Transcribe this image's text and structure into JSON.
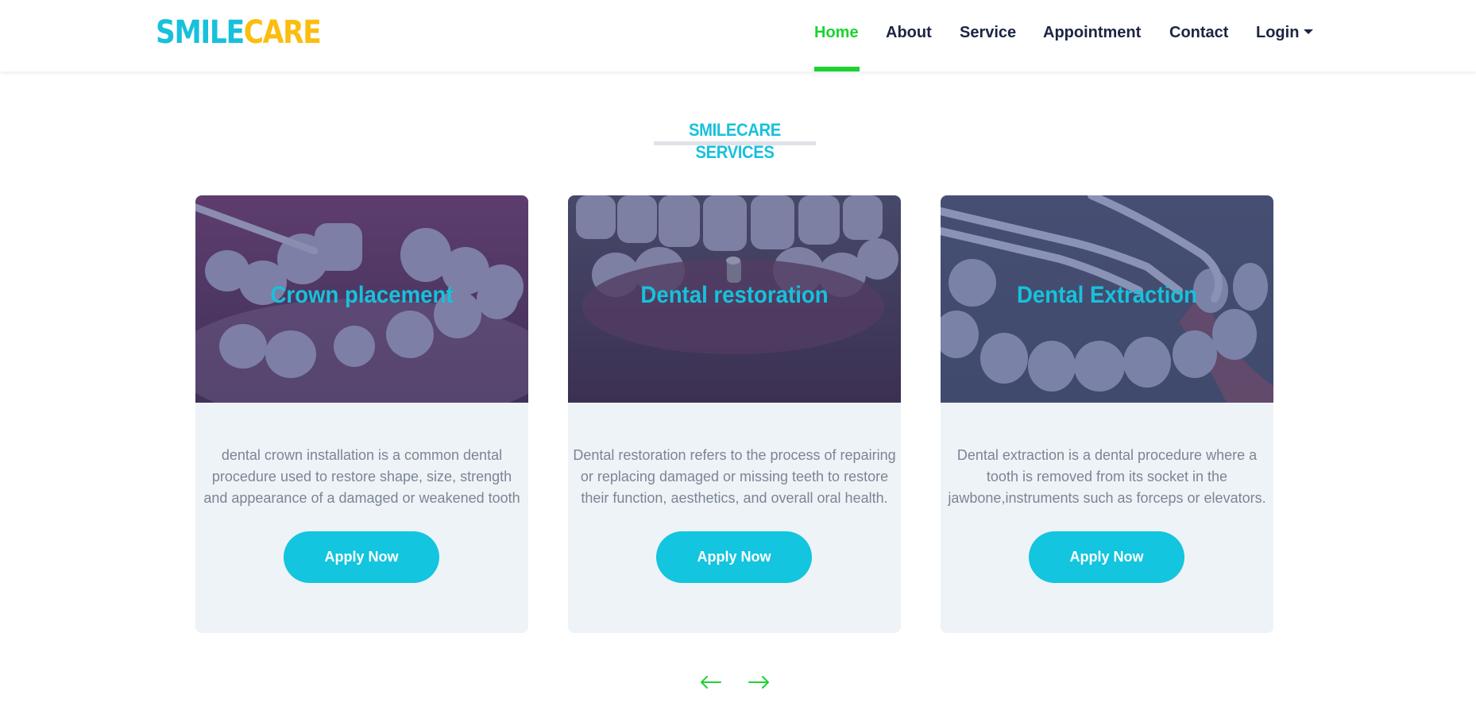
{
  "brand": {
    "part1": "SMILE",
    "part2": "CARE"
  },
  "nav": {
    "items": [
      "Home",
      "About",
      "Service",
      "Appointment",
      "Contact",
      "Login"
    ],
    "active": "Home"
  },
  "section": {
    "title": "SMILECARE SERVICES"
  },
  "cards": [
    {
      "title": "Crown placement",
      "description": "dental crown installation is a common dental procedure used to restore shape, size, strength and appearance of a damaged or weakened tooth",
      "button": "Apply Now"
    },
    {
      "title": "Dental restoration",
      "description": "Dental restoration refers to the process of repairing or replacing damaged or missing teeth to restore their function, aesthetics, and overall oral health.",
      "button": "Apply Now"
    },
    {
      "title": "Dental Extraction",
      "description": "Dental extraction is a dental procedure where a tooth is removed from its socket in the jawbone,instruments such as forceps or elevators.",
      "button": "Apply Now"
    }
  ],
  "carousel": {
    "prev_icon": "arrow-left-icon",
    "next_icon": "arrow-right-icon"
  },
  "colors": {
    "brand_primary": "#17c1db",
    "brand_secondary": "#fbbd0f",
    "nav_active": "#1ad331",
    "nav_text": "#1c2543",
    "button": "#13c5de",
    "card_bg": "#eef3f7",
    "description": "#7b8595"
  }
}
